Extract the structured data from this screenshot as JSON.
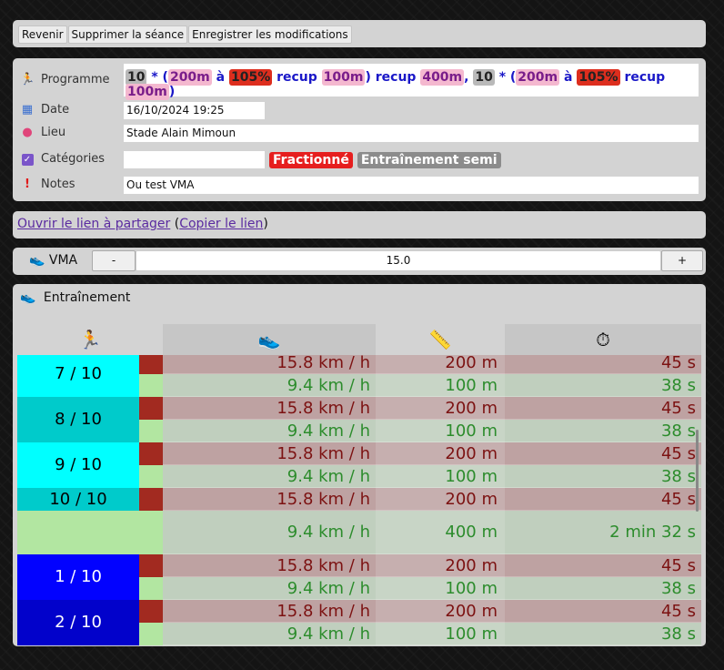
{
  "toolbar": {
    "back": "Revenir",
    "delete": "Supprimer la séance",
    "save": "Enregistrer les modifications"
  },
  "form": {
    "program_label": "Programme",
    "program_tokens": [
      {
        "t": "10",
        "k": "n"
      },
      {
        "t": " * (",
        "k": "b"
      },
      {
        "t": "200m",
        "k": "d"
      },
      {
        "t": " à ",
        "k": "b"
      },
      {
        "t": "105%",
        "k": "p"
      },
      {
        "t": " recup ",
        "k": "b"
      },
      {
        "t": "100m",
        "k": "d"
      },
      {
        "t": ") recup ",
        "k": "b"
      },
      {
        "t": "400m",
        "k": "d"
      },
      {
        "t": ", ",
        "k": "b"
      },
      {
        "t": "10",
        "k": "n"
      },
      {
        "t": " * (",
        "k": "b"
      },
      {
        "t": "200m",
        "k": "d"
      },
      {
        "t": " à ",
        "k": "b"
      },
      {
        "t": "105%",
        "k": "p"
      },
      {
        "t": " recup ",
        "k": "b"
      },
      {
        "t": "100m",
        "k": "d"
      },
      {
        "t": ")",
        "k": "b"
      }
    ],
    "date_label": "Date",
    "date_value": "16/10/2024 19:25",
    "place_label": "Lieu",
    "place_value": "Stade Alain Mimoun",
    "categories_label": "Catégories",
    "categories": [
      {
        "label": "Fractionné",
        "color": "#e61e1e"
      },
      {
        "label": "Entraînement semi",
        "color": "#8c8c8c"
      }
    ],
    "notes_label": "Notes",
    "notes_value": "Ou test VMA"
  },
  "share": {
    "open_link": "Ouvrir le lien à partager",
    "copy_link": "Copier le lien"
  },
  "vma": {
    "label": "VMA",
    "minus": "-",
    "value": "15.0",
    "plus": "+"
  },
  "training": {
    "title": "Entraînement",
    "columns": [
      "runner-icon",
      "shoe-icon",
      "ruler-icon",
      "stopwatch-icon"
    ],
    "rows": [
      {
        "rep": "7 / 10",
        "repColor": "#00ffff",
        "efforts": [
          {
            "speed": "15.8 km / h",
            "dist": "200 m",
            "time": "45 s",
            "kind": "fast"
          },
          {
            "speed": "9.4 km / h",
            "dist": "100 m",
            "time": "38 s",
            "kind": "slow"
          }
        ]
      },
      {
        "rep": "8 / 10",
        "repColor": "#00cbcb",
        "efforts": [
          {
            "speed": "15.8 km / h",
            "dist": "200 m",
            "time": "45 s",
            "kind": "fast"
          },
          {
            "speed": "9.4 km / h",
            "dist": "100 m",
            "time": "38 s",
            "kind": "slow"
          }
        ]
      },
      {
        "rep": "9 / 10",
        "repColor": "#00ffff",
        "efforts": [
          {
            "speed": "15.8 km / h",
            "dist": "200 m",
            "time": "45 s",
            "kind": "fast"
          },
          {
            "speed": "9.4 km / h",
            "dist": "100 m",
            "time": "38 s",
            "kind": "slow"
          }
        ]
      },
      {
        "rep": "10 / 10",
        "repColor": "#00cbcb",
        "efforts": [
          {
            "speed": "15.8 km / h",
            "dist": "200 m",
            "time": "45 s",
            "kind": "fast"
          }
        ]
      },
      {
        "rep": "",
        "repColor": "#b2e6a1",
        "efforts": [
          {
            "speed": "9.4 km / h",
            "dist": "400 m",
            "time": "2 min 32 s",
            "kind": "slow",
            "tall": true
          }
        ]
      },
      {
        "rep": "1 / 10",
        "repColor": "#0202ff",
        "repText": "#ffffff",
        "efforts": [
          {
            "speed": "15.8 km / h",
            "dist": "200 m",
            "time": "45 s",
            "kind": "fast"
          },
          {
            "speed": "9.4 km / h",
            "dist": "100 m",
            "time": "38 s",
            "kind": "slow"
          }
        ]
      },
      {
        "rep": "2 / 10",
        "repColor": "#0202cb",
        "repText": "#ffffff",
        "efforts": [
          {
            "speed": "15.8 km / h",
            "dist": "200 m",
            "time": "45 s",
            "kind": "fast"
          },
          {
            "speed": "9.4 km / h",
            "dist": "100 m",
            "time": "38 s",
            "kind": "slow"
          }
        ]
      }
    ]
  }
}
